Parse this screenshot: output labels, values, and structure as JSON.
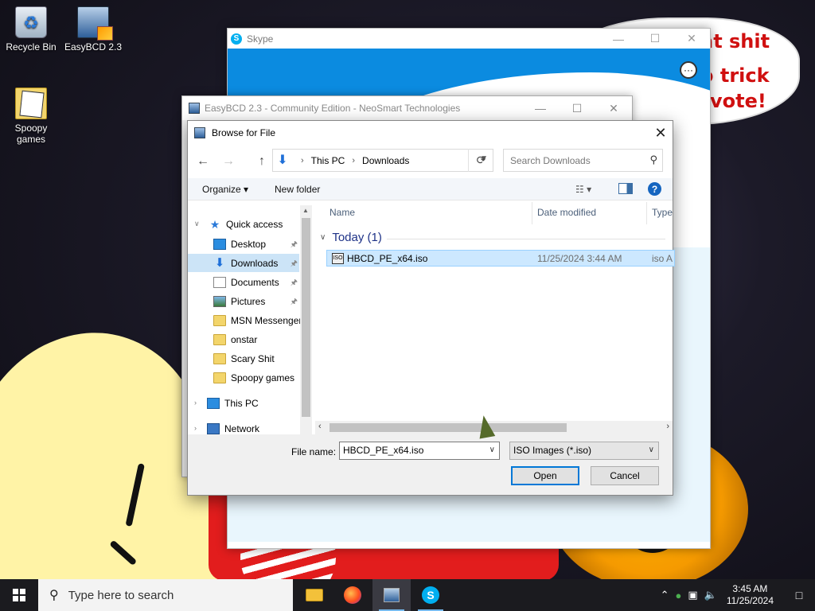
{
  "desktop": {
    "icons": [
      {
        "label": "Recycle Bin",
        "icon": "recycle-bin-icon"
      },
      {
        "label": "EasyBCD 2.3",
        "icon": "easybcd-icon"
      },
      {
        "label": "Spoopy games",
        "icon": "folder-icon"
      }
    ],
    "wallpaper_text": [
      "at shit",
      "o trick",
      "vote!"
    ]
  },
  "skype": {
    "title": "Skype",
    "more_glyph": "···"
  },
  "easybcd": {
    "title": "EasyBCD 2.3 - Community Edition - NeoSmart Technologies"
  },
  "dialog": {
    "title": "Browse for File",
    "address": {
      "segments": [
        "This PC",
        "Downloads"
      ]
    },
    "search_placeholder": "Search Downloads",
    "toolbar": {
      "organize": "Organize",
      "new_folder": "New folder"
    },
    "nav": {
      "quick_access": "Quick access",
      "items": [
        {
          "label": "Desktop",
          "icon": "desktop-icon",
          "pinned": true
        },
        {
          "label": "Downloads",
          "icon": "downloads-icon",
          "pinned": true,
          "selected": true
        },
        {
          "label": "Documents",
          "icon": "documents-icon",
          "pinned": true
        },
        {
          "label": "Pictures",
          "icon": "pictures-icon",
          "pinned": true
        },
        {
          "label": "MSN Messenger",
          "icon": "folder-icon"
        },
        {
          "label": "onstar",
          "icon": "folder-icon"
        },
        {
          "label": "Scary Shit",
          "icon": "folder-icon"
        },
        {
          "label": "Spoopy games",
          "icon": "folder-icon"
        }
      ],
      "this_pc": "This PC",
      "network": "Network"
    },
    "columns": {
      "name": "Name",
      "date": "Date modified",
      "type": "Type"
    },
    "group": "Today (1)",
    "files": [
      {
        "name": "HBCD_PE_x64.iso",
        "date": "11/25/2024 3:44 AM",
        "type": "iso A"
      }
    ],
    "file_name_label": "File name:",
    "file_name_value": "HBCD_PE_x64.iso",
    "file_type_value": "ISO Images (*.iso)",
    "open_label": "Open",
    "cancel_label": "Cancel"
  },
  "taskbar": {
    "search_placeholder": "Type here to search",
    "apps": [
      "file-explorer",
      "firefox",
      "easybcd",
      "skype"
    ],
    "active_app": "easybcd",
    "time": "3:45 AM",
    "date": "11/25/2024"
  },
  "colors": {
    "accent": "#0078d7",
    "selection": "#cce8ff",
    "taskbar": "#1b1b1f",
    "skype_blue": "#00aff0"
  }
}
